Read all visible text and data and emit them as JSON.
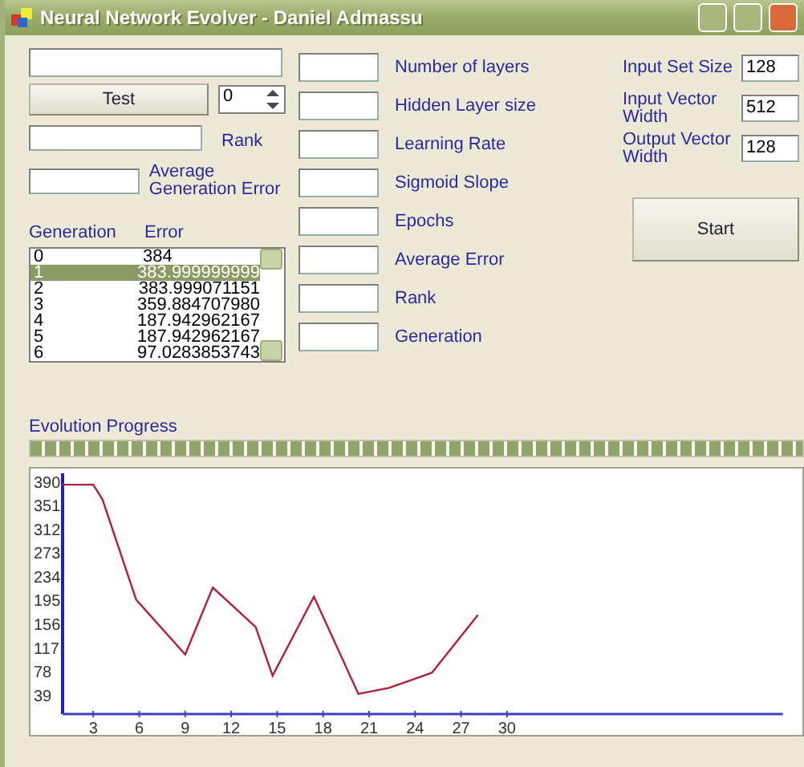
{
  "window": {
    "title": "Neural Network Evolver - Daniel Admassu"
  },
  "test_panel": {
    "test_button": "Test",
    "spinner_value": "0",
    "rank_label": "Rank",
    "average_error_label": "Average Generation Error"
  },
  "generation_list": {
    "columns": [
      "Generation",
      "Error"
    ],
    "rows": [
      {
        "generation": "0",
        "error": "384",
        "selected": false
      },
      {
        "generation": "1",
        "error": "383.999999999",
        "selected": true
      },
      {
        "generation": "2",
        "error": "383.999071151",
        "selected": false
      },
      {
        "generation": "3",
        "error": "359.884707980",
        "selected": false
      },
      {
        "generation": "4",
        "error": "187.942962167",
        "selected": false
      },
      {
        "generation": "5",
        "error": "187.942962167",
        "selected": false
      },
      {
        "generation": "6",
        "error": "97.0283853743",
        "selected": false
      }
    ]
  },
  "parameters": [
    {
      "label": "Number of layers"
    },
    {
      "label": "Hidden Layer size"
    },
    {
      "label": "Learning Rate"
    },
    {
      "label": "Sigmoid Slope"
    },
    {
      "label": "Epochs"
    },
    {
      "label": "Average Error"
    },
    {
      "label": "Rank"
    },
    {
      "label": "Generation"
    }
  ],
  "settings": [
    {
      "label": "Input Set Size",
      "value": "128"
    },
    {
      "label": "Input Vector Width",
      "value": "512"
    },
    {
      "label": "Output Vector Width",
      "value": "128"
    }
  ],
  "start_button": "Start",
  "progress": {
    "label": "Evolution Progress",
    "level": 1
  },
  "chart": {
    "chart_data": {
      "type": "line",
      "xlim": [
        1,
        48
      ],
      "ylim": [
        7,
        400
      ],
      "xticks": [
        3,
        6,
        9,
        12,
        15,
        18,
        21,
        24,
        27,
        30
      ],
      "yticks": [
        39,
        78,
        117,
        156,
        195,
        234,
        273,
        312,
        351,
        390
      ],
      "series": [
        {
          "color": "#b02038",
          "values": [
            384,
            384,
            360,
            195,
            105,
            215,
            150,
            70,
            200,
            40,
            50,
            75,
            170
          ]
        }
      ],
      "x": [
        1,
        3,
        3.6,
        5.8,
        9,
        10.8,
        13.6,
        14.7,
        17.4,
        20.3,
        22.3,
        25.1,
        28.1
      ]
    }
  }
}
